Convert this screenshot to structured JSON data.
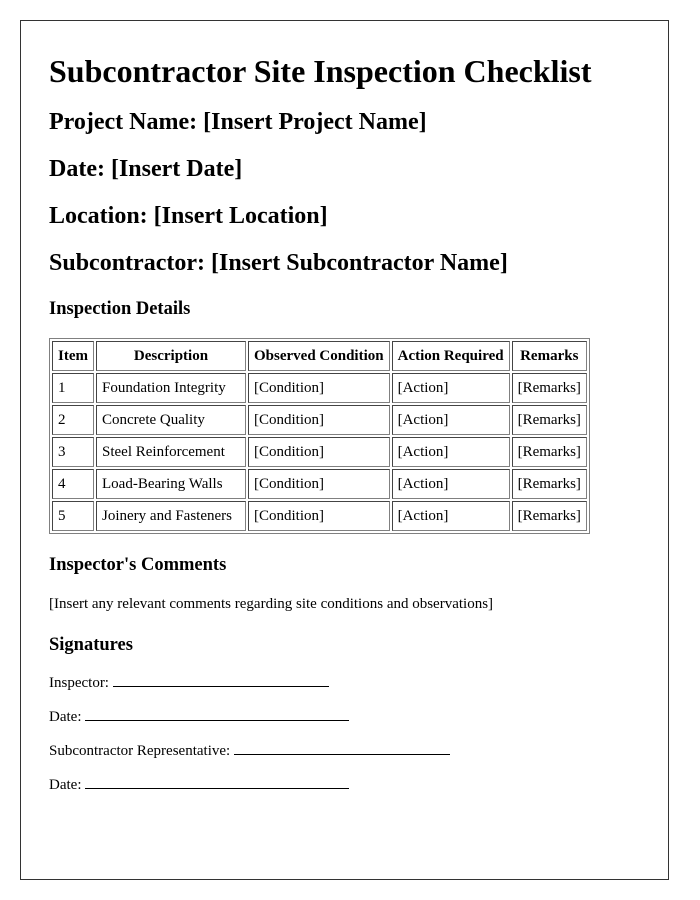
{
  "document": {
    "title": "Subcontractor Site Inspection Checklist",
    "fields": [
      {
        "label": "Project Name:",
        "value": "[Insert Project Name]"
      },
      {
        "label": "Date:",
        "value": "[Insert Date]"
      },
      {
        "label": "Location:",
        "value": "[Insert Location]"
      },
      {
        "label": "Subcontractor:",
        "value": "[Insert Subcontractor Name]"
      }
    ],
    "inspection": {
      "heading": "Inspection Details",
      "columns": [
        "Item",
        "Description",
        "Observed Condition",
        "Action Required",
        "Remarks"
      ],
      "rows": [
        [
          "1",
          "Foundation Integrity",
          "[Condition]",
          "[Action]",
          "[Remarks]"
        ],
        [
          "2",
          "Concrete Quality",
          "[Condition]",
          "[Action]",
          "[Remarks]"
        ],
        [
          "3",
          "Steel Reinforcement",
          "[Condition]",
          "[Action]",
          "[Remarks]"
        ],
        [
          "4",
          "Load-Bearing Walls",
          "[Condition]",
          "[Action]",
          "[Remarks]"
        ],
        [
          "5",
          "Joinery and Fasteners",
          "[Condition]",
          "[Action]",
          "[Remarks]"
        ]
      ]
    },
    "comments": {
      "heading": "Inspector's Comments",
      "text": "[Insert any relevant comments regarding site conditions and observations]"
    },
    "signatures": {
      "heading": "Signatures",
      "lines": [
        {
          "label": "Inspector:"
        },
        {
          "label": "Date:"
        },
        {
          "label": "Subcontractor Representative:"
        },
        {
          "label": "Date:"
        }
      ]
    }
  }
}
